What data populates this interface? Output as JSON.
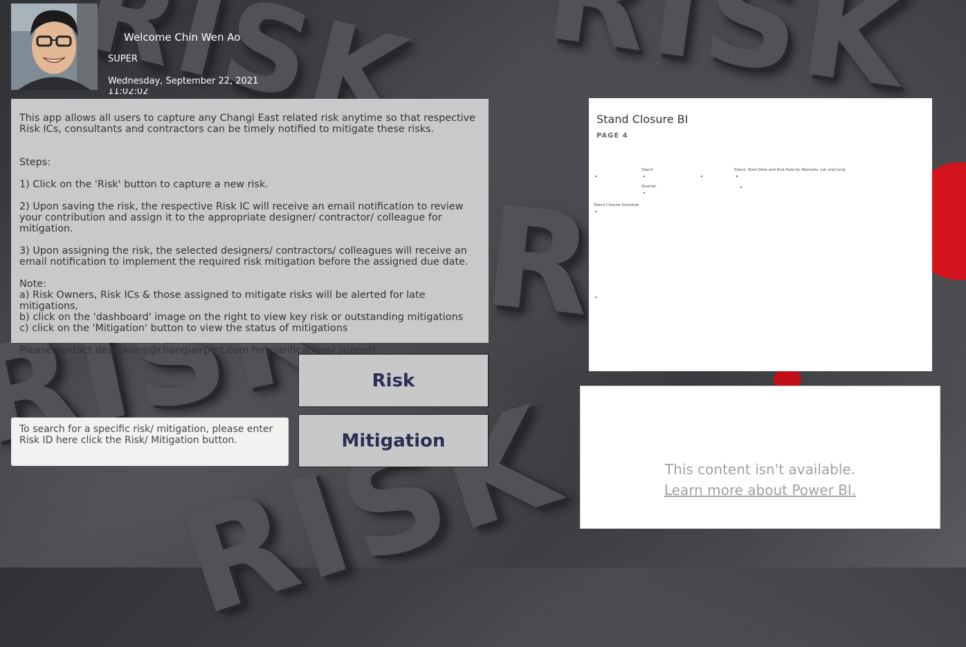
{
  "header": {
    "welcome": "Welcome Chin Wen Ao",
    "role": "SUPER",
    "date": "Wednesday, September 22, 2021",
    "time": "11:02:02"
  },
  "info": {
    "intro": "This app allows all users to capture any Changi East related risk anytime so that respective Risk ICs, consultants and contractors can be timely notified to mitigate these risks.",
    "steps_label": "Steps:",
    "step1": "1) Click on the 'Risk' button to capture a new risk.",
    "step2": "2) Upon saving the risk, the respective Risk IC will receive an email notification to review your contribution and assign it to the appropriate designer/ contractor/ colleague for mitigation.",
    "step3": "3) Upon assigning the risk, the selected designers/ contractors/ colleagues will receive an email notification to implement the required risk mitigation before the assigned due date.",
    "note": "Note:\na) Risk Owners, Risk ICs & those assigned to mitigate risks will be alerted for late mitigations,\nb) click on the 'dashboard' image on the right to view key risk or outstanding mitigations\nc) click on the 'Mitigation' button to view the status of mitigations",
    "contact": "Please contact dean.kong@changiairport.com for clarifications/ support"
  },
  "search": {
    "placeholder": "To search for a specific risk/ mitigation, please enter Risk ID here click the Risk/ Mitigation button."
  },
  "buttons": {
    "risk": "Risk",
    "mitigation": "Mitigation"
  },
  "powerbi": {
    "title": "Stand Closure BI",
    "page": "PAGE 4",
    "label_stand": "Stand",
    "label_map": "Stand, Start Date and End Date by Remarks, Lat and Long",
    "label_quarter": "Quarter",
    "label_schedule": "Stand Closure Schedule"
  },
  "unavailable": {
    "message": "This content isn't available.",
    "link": "Learn more about Power BI."
  },
  "background": {
    "word": "RISK"
  },
  "colors": {
    "button_text": "#2a2f55",
    "panel_bg": "#c9c9c9",
    "accent_red": "#d4141c"
  }
}
